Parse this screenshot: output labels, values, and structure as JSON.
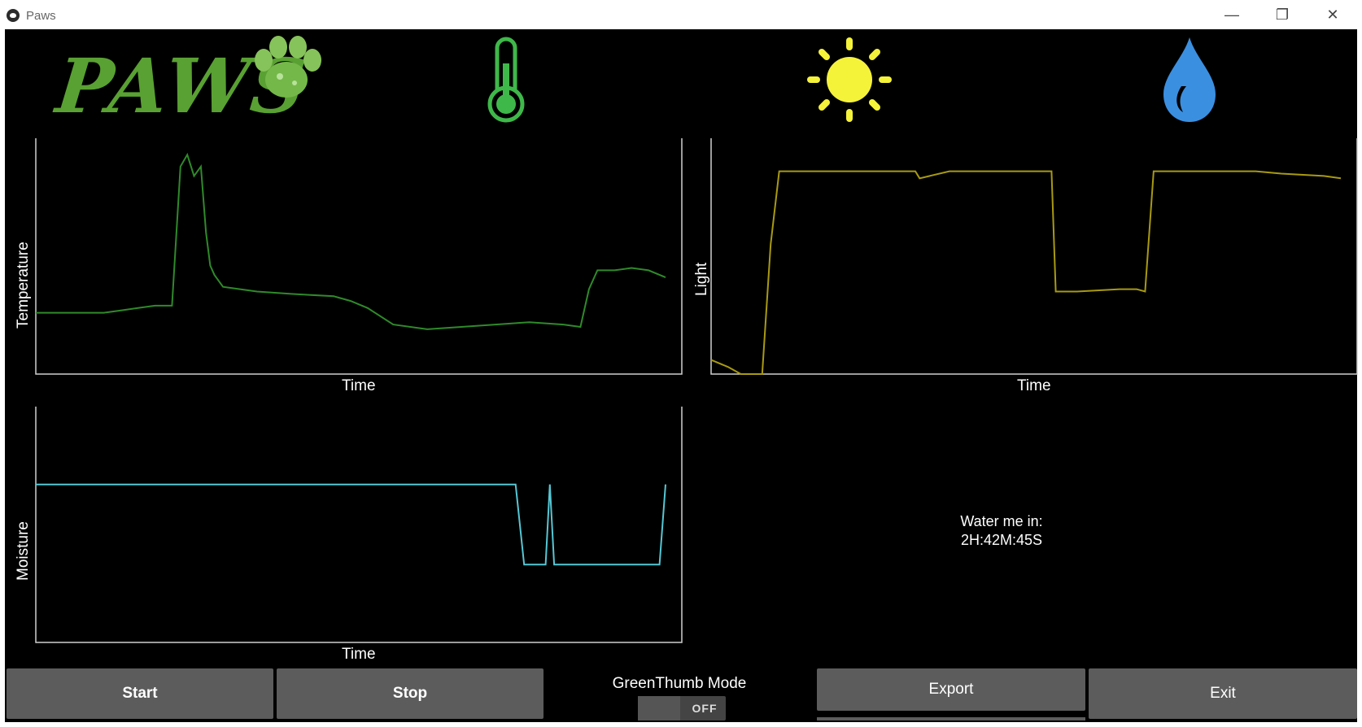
{
  "window": {
    "title": "Paws",
    "minimize_glyph": "—",
    "maximize_glyph": "❐",
    "close_glyph": "✕"
  },
  "header": {
    "logo_text": "PAWS",
    "icons": [
      "paw-icon",
      "thermometer-icon",
      "sun-icon",
      "water-drop-icon"
    ]
  },
  "charts": {
    "temperature": {
      "xlabel": "Time",
      "ylabel": "Temperature",
      "color": "#2f8a2a"
    },
    "light": {
      "xlabel": "Time",
      "ylabel": "Light",
      "color": "#a89a12"
    },
    "moisture": {
      "xlabel": "Time",
      "ylabel": "Moisture",
      "color": "#56c7d4"
    }
  },
  "chart_data": [
    {
      "type": "line",
      "xlabel": "Time",
      "ylabel": "Temperature",
      "x": [
        0,
        20,
        40,
        60,
        80,
        100,
        120,
        140,
        160,
        170,
        178,
        186,
        194,
        200,
        205,
        210,
        220,
        240,
        260,
        300,
        350,
        370,
        390,
        420,
        460,
        500,
        540,
        580,
        620,
        640,
        650,
        660,
        680,
        700,
        720,
        740
      ],
      "y": [
        0.26,
        0.26,
        0.26,
        0.26,
        0.26,
        0.27,
        0.28,
        0.29,
        0.29,
        0.88,
        0.93,
        0.84,
        0.88,
        0.6,
        0.46,
        0.42,
        0.37,
        0.36,
        0.35,
        0.34,
        0.33,
        0.31,
        0.28,
        0.21,
        0.19,
        0.2,
        0.21,
        0.22,
        0.21,
        0.2,
        0.36,
        0.44,
        0.44,
        0.45,
        0.44,
        0.41
      ]
    },
    {
      "type": "line",
      "xlabel": "Time",
      "ylabel": "Light",
      "x": [
        0,
        20,
        35,
        50,
        60,
        70,
        80,
        100,
        140,
        200,
        240,
        245,
        280,
        350,
        400,
        405,
        430,
        480,
        500,
        510,
        520,
        540,
        580,
        640,
        670,
        720,
        740
      ],
      "y": [
        0.06,
        0.03,
        0.0,
        0.0,
        0.0,
        0.55,
        0.86,
        0.86,
        0.86,
        0.86,
        0.86,
        0.83,
        0.86,
        0.86,
        0.86,
        0.35,
        0.35,
        0.36,
        0.36,
        0.35,
        0.86,
        0.86,
        0.86,
        0.86,
        0.85,
        0.84,
        0.83
      ]
    },
    {
      "type": "line",
      "xlabel": "Time",
      "ylabel": "Moisture",
      "x": [
        0,
        200,
        400,
        560,
        570,
        575,
        595,
        600,
        605,
        610,
        630,
        680,
        720,
        728,
        735
      ],
      "y": [
        0.67,
        0.67,
        0.67,
        0.67,
        0.33,
        0.33,
        0.33,
        0.67,
        0.33,
        0.33,
        0.33,
        0.33,
        0.33,
        0.33,
        0.67
      ]
    }
  ],
  "water_status": {
    "label": "Water me in:",
    "countdown": "2H:42M:45S"
  },
  "controls": {
    "start_label": "Start",
    "stop_label": "Stop",
    "mode_label": "GreenThumb Mode",
    "mode_state": "OFF",
    "export_label": "Export",
    "exit_label": "Exit"
  }
}
